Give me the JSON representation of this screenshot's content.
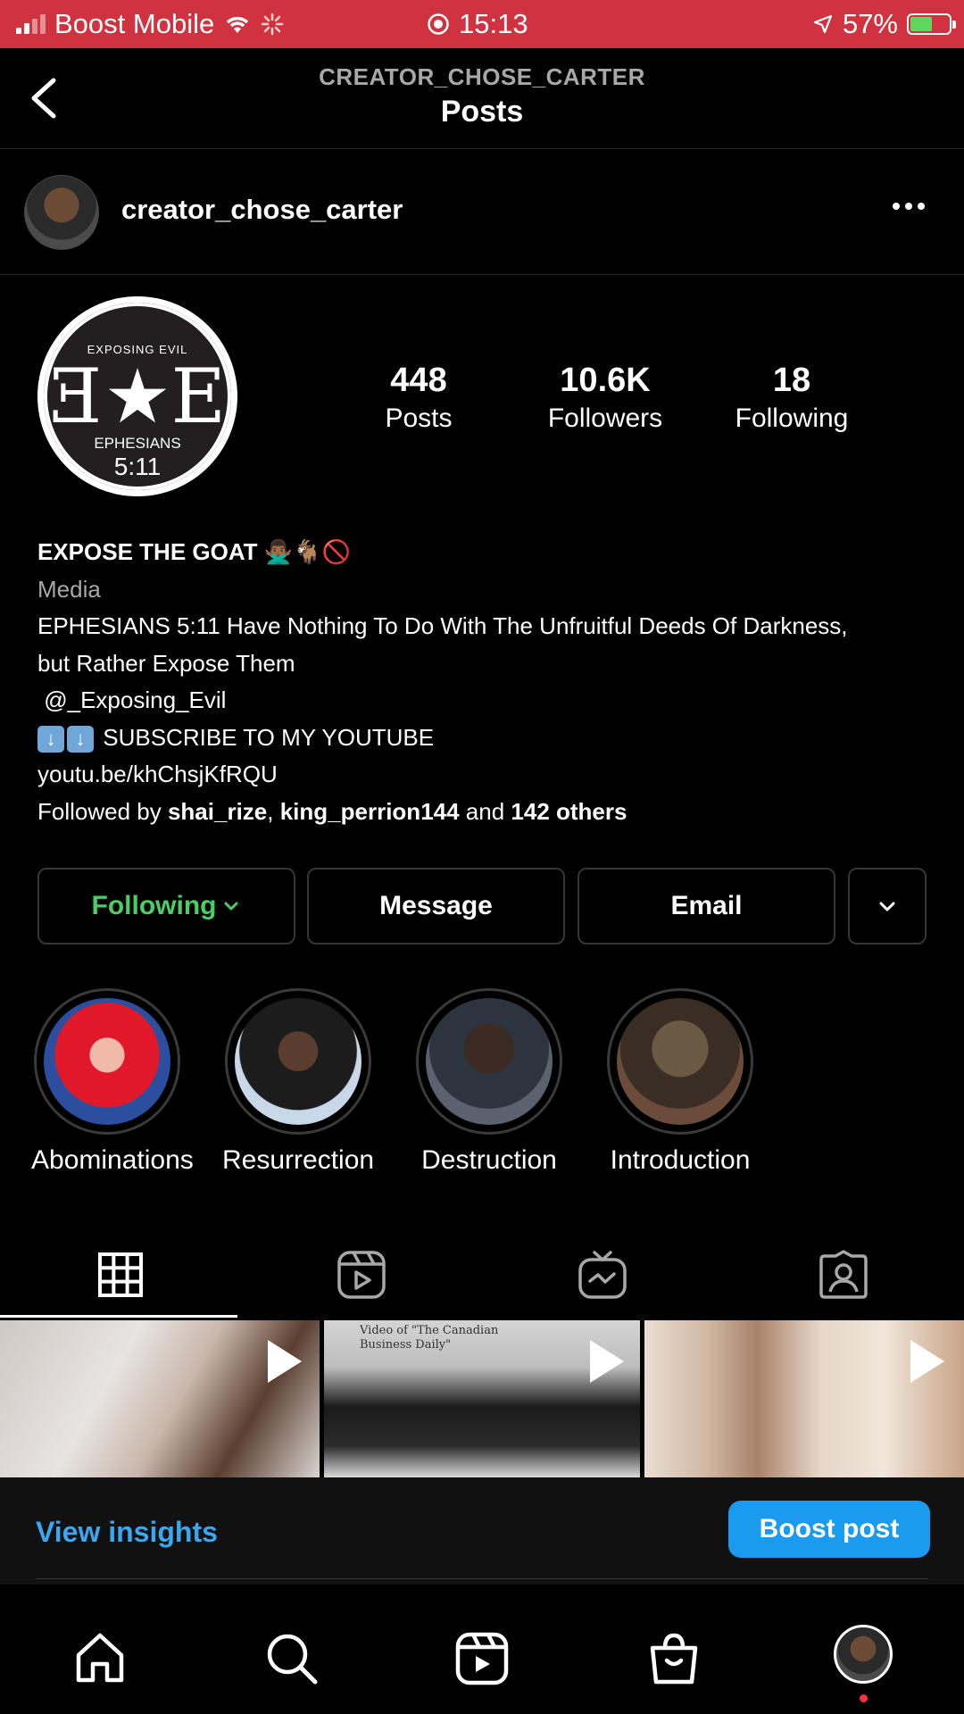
{
  "status_bar": {
    "carrier": "Boost Mobile",
    "time": "15:13",
    "battery": "57%",
    "battery_level": 0.57,
    "colors": {
      "background": "#d0333f",
      "battery_fill": "#5dd85d"
    }
  },
  "header": {
    "subtitle": "CREATOR_CHOSE_CARTER",
    "title": "Posts"
  },
  "post_owner": {
    "username": "creator_chose_carter"
  },
  "profile": {
    "logo": {
      "top": "EXPOSING   EVIL",
      "letters": "Ǝ★E",
      "bottom": "EPHESIANS",
      "number": "5:11"
    },
    "stats": [
      {
        "value": "448",
        "label": "Posts"
      },
      {
        "value": "10.6K",
        "label": "Followers"
      },
      {
        "value": "18",
        "label": "Following"
      }
    ],
    "name": "EXPOSE THE GOAT",
    "name_emojis": "🙅🏾‍♂️🐐🚫",
    "category": "Media",
    "bio_line1": "EPHESIANS 5:11 Have Nothing To Do With The Unfruitful Deeds Of Darkness,",
    "bio_line2": "but Rather Expose Them",
    "bio_line3": " @_Exposing_Evil",
    "bio_line4": "SUBSCRIBE TO MY YOUTUBE",
    "bio_line5": "youtu.be/khChsjKfRQU",
    "followed_by_prefix": "Followed by ",
    "followed_by_user1": "shai_rize",
    "followed_by_sep": ", ",
    "followed_by_user2": "king_perrion144",
    "followed_by_and": " and ",
    "followed_by_others": "142 others"
  },
  "actions": {
    "following": "Following",
    "message": "Message",
    "email": "Email"
  },
  "highlights": [
    {
      "label": "Abominations"
    },
    {
      "label": "Resurrection"
    },
    {
      "label": "Destruction"
    },
    {
      "label": "Introduction"
    }
  ],
  "grid": {
    "cell2_caption": "Video of \"The Canadian Business Daily\""
  },
  "insights": {
    "view_insights": "View insights",
    "boost_post": "Boost post",
    "colors": {
      "link": "#3aa7f0",
      "button": "#1a9bf0"
    }
  },
  "icons": {
    "tabs": [
      "grid-icon",
      "reels-icon",
      "igtv-icon",
      "tagged-icon"
    ],
    "nav": [
      "home-icon",
      "search-icon",
      "reels-icon",
      "shop-icon",
      "profile-avatar"
    ]
  }
}
